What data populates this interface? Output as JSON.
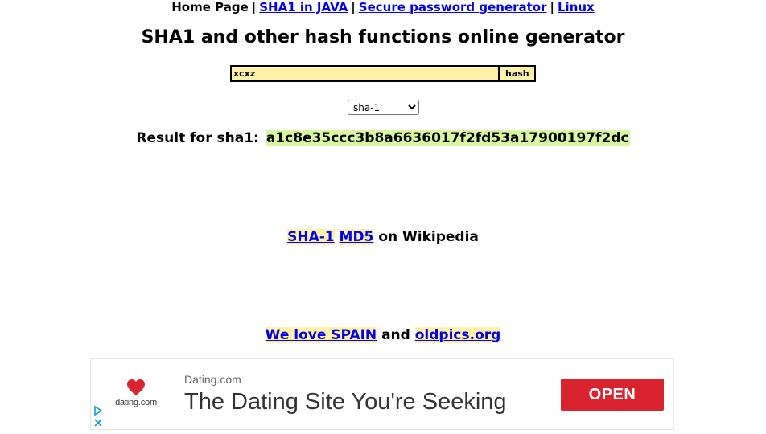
{
  "nav": {
    "home": "Home Page",
    "sep1": "|",
    "sha1_java": "SHA1 in JAVA",
    "sep2": "|",
    "password_gen": "Secure password generator",
    "sep3": "|",
    "linux": "Linux"
  },
  "title": "SHA1 and other hash functions online generator",
  "form": {
    "input_value": "xcxz",
    "hash_button": "hash",
    "algorithm_selected": "sha-1"
  },
  "result": {
    "label": "Result for sha1:",
    "value": "a1c8e35ccc3b8a6636017f2fd53a17900197f2dc"
  },
  "wiki": {
    "sha1_link": "SHA-1",
    "md5_link": "MD5",
    "suffix": "on Wikipedia"
  },
  "promo": {
    "spain_link": "We love SPAIN",
    "and": "and",
    "oldpics_link": "oldpics.org"
  },
  "ad": {
    "logo_text": "dating.com",
    "site": "Dating.com",
    "headline": "The Dating Site You're Seeking",
    "open_button": "OPEN"
  },
  "colors": {
    "input_bg": "#fff1a8",
    "result_bg": "#d8f7a0",
    "link": "#0000ee",
    "ad_button": "#d9232e",
    "ad_logo_heart": "#d9232e"
  },
  "icons": {
    "ad_logo": "heart-icon",
    "ad_choices_play": "play-triangle-icon",
    "ad_close": "close-icon"
  }
}
